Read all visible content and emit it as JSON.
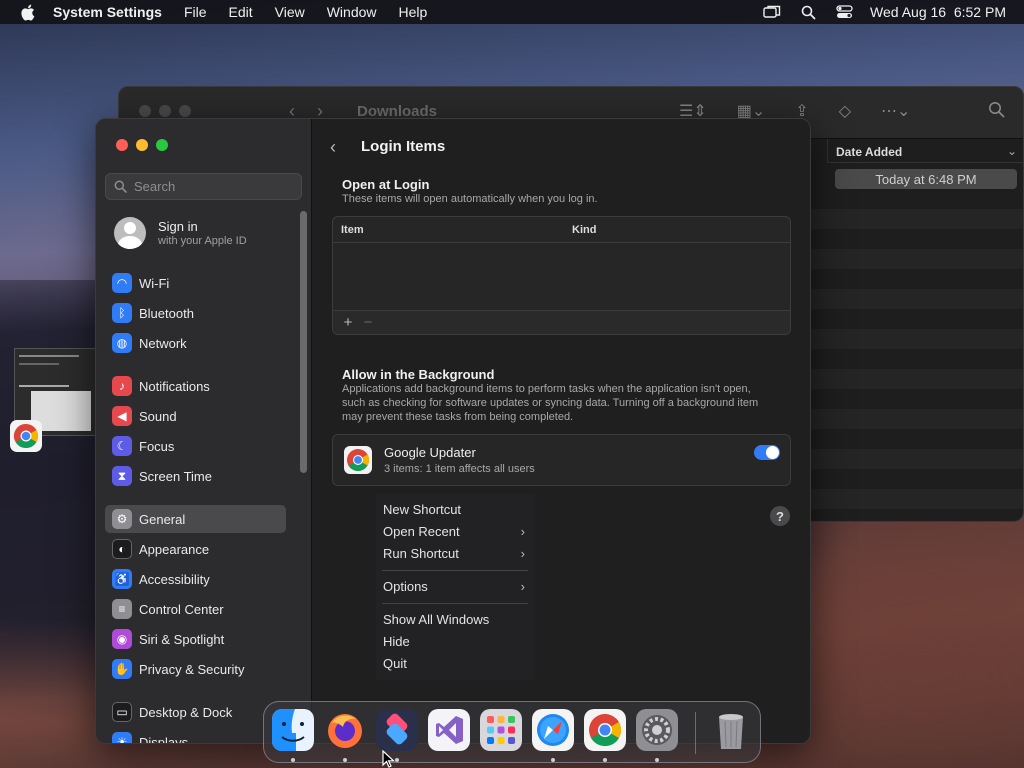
{
  "menubar": {
    "app_name": "System Settings",
    "menus": [
      "File",
      "Edit",
      "View",
      "Window",
      "Help"
    ],
    "datetime": "Wed Aug 16  6:52 PM"
  },
  "finder": {
    "title": "Downloads",
    "column_header": "Date Added",
    "selected_row_date": "Today at 6:48 PM"
  },
  "settings": {
    "search_placeholder": "Search",
    "signin": {
      "title": "Sign in",
      "subtitle": "with your Apple ID"
    },
    "sidebar": [
      {
        "label": "Wi-Fi",
        "icon": "wifi-icon",
        "color": "#2f7cf6"
      },
      {
        "label": "Bluetooth",
        "icon": "bluetooth-icon",
        "color": "#2f7cf6"
      },
      {
        "label": "Network",
        "icon": "globe-icon",
        "color": "#2f7cf6"
      },
      {
        "label": "Notifications",
        "icon": "bell-icon",
        "color": "#e5484d"
      },
      {
        "label": "Sound",
        "icon": "speaker-icon",
        "color": "#e5484d"
      },
      {
        "label": "Focus",
        "icon": "moon-icon",
        "color": "#5e5ce6"
      },
      {
        "label": "Screen Time",
        "icon": "hourglass-icon",
        "color": "#5e5ce6"
      },
      {
        "label": "General",
        "icon": "gear-icon",
        "color": "#8e8e93",
        "active": true
      },
      {
        "label": "Appearance",
        "icon": "appearance-icon",
        "color": "#1c1c1e"
      },
      {
        "label": "Accessibility",
        "icon": "accessibility-icon",
        "color": "#2f7cf6"
      },
      {
        "label": "Control Center",
        "icon": "toggles-icon",
        "color": "#8e8e93"
      },
      {
        "label": "Siri & Spotlight",
        "icon": "siri-icon",
        "color": "#b04ad9"
      },
      {
        "label": "Privacy & Security",
        "icon": "hand-icon",
        "color": "#2f7cf6"
      },
      {
        "label": "Desktop & Dock",
        "icon": "dock-icon",
        "color": "#1c1c1e"
      },
      {
        "label": "Displays",
        "icon": "display-icon",
        "color": "#2f7cf6"
      }
    ],
    "page_title": "Login Items",
    "open_at_login": {
      "heading": "Open at Login",
      "description": "These items will open automatically when you log in.",
      "columns": [
        "Item",
        "Kind"
      ],
      "add_label": "+",
      "remove_label": "−"
    },
    "background": {
      "heading": "Allow in the Background",
      "description": "Applications add background items to perform tasks when the application isn't open, such as checking for software updates or syncing data. Turning off a background item may prevent these tasks from being completed.",
      "items": [
        {
          "name": "Google Updater",
          "detail": "3 items: 1 item affects all users",
          "enabled": true
        }
      ]
    },
    "help_label": "?"
  },
  "context_menu": {
    "items": [
      {
        "label": "New Shortcut",
        "submenu": false
      },
      {
        "label": "Open Recent",
        "submenu": true
      },
      {
        "label": "Run Shortcut",
        "submenu": true
      },
      {
        "label": "Options",
        "submenu": true
      },
      {
        "label": "Show All Windows",
        "submenu": false
      },
      {
        "label": "Hide",
        "submenu": false
      },
      {
        "label": "Quit",
        "submenu": false
      }
    ]
  },
  "dock": {
    "apps": [
      {
        "name": "Finder",
        "icon": "finder-icon",
        "running": true
      },
      {
        "name": "Firefox",
        "icon": "firefox-icon",
        "running": true
      },
      {
        "name": "Shortcuts",
        "icon": "shortcuts-icon",
        "running": true
      },
      {
        "name": "Visual Studio",
        "icon": "visual-studio-icon",
        "running": false
      },
      {
        "name": "Launchpad",
        "icon": "launchpad-icon",
        "running": false
      },
      {
        "name": "Safari",
        "icon": "safari-icon",
        "running": true
      },
      {
        "name": "Google Chrome",
        "icon": "chrome-icon",
        "running": true
      },
      {
        "name": "System Settings",
        "icon": "system-settings-icon",
        "running": true
      },
      {
        "name": "Trash",
        "icon": "trash-icon",
        "running": false
      }
    ]
  }
}
